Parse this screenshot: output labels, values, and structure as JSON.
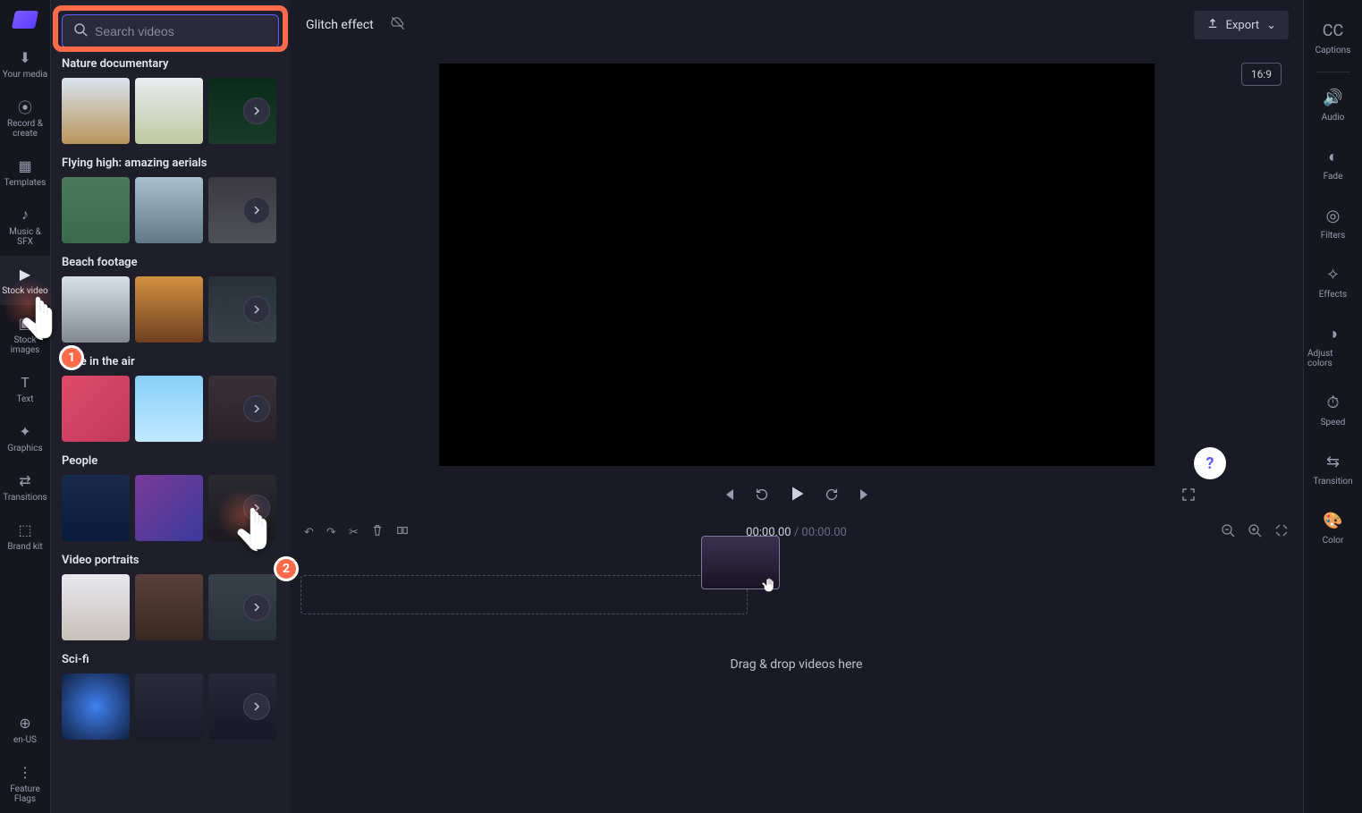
{
  "leftSidebar": [
    {
      "id": "your-media",
      "label": "Your media",
      "icon": "⬇"
    },
    {
      "id": "record",
      "label": "Record & create",
      "icon": "⦿"
    },
    {
      "id": "templates",
      "label": "Templates",
      "icon": "▦"
    },
    {
      "id": "music",
      "label": "Music & SFX",
      "icon": "♪"
    },
    {
      "id": "stock-video",
      "label": "Stock video",
      "icon": "▶",
      "active": true
    },
    {
      "id": "stock-images",
      "label": "Stock images",
      "icon": "▣"
    },
    {
      "id": "text",
      "label": "Text",
      "icon": "T"
    },
    {
      "id": "graphics",
      "label": "Graphics",
      "icon": "✦"
    },
    {
      "id": "transitions",
      "label": "Transitions",
      "icon": "⇄"
    },
    {
      "id": "brand-kit",
      "label": "Brand kit",
      "icon": "⬚"
    }
  ],
  "leftBottom": [
    {
      "id": "locale",
      "label": "en-US",
      "icon": "⊕"
    },
    {
      "id": "feature-flags",
      "label": "Feature Flags",
      "icon": "⋮"
    }
  ],
  "search": {
    "placeholder": "Search videos"
  },
  "categories": [
    {
      "title": "Nature documentary",
      "thumbs": [
        "t-wheat",
        "t-wheat2",
        "t-forest"
      ]
    },
    {
      "title": "Flying high: amazing aerials",
      "thumbs": [
        "t-aerial1",
        "t-aerial2",
        "t-aerial3"
      ]
    },
    {
      "title": "Beach footage",
      "thumbs": [
        "t-beach1",
        "t-beach2",
        "t-beach3"
      ]
    },
    {
      "title": "Love in the air",
      "thumbs": [
        "t-love1",
        "t-love2",
        "t-love3"
      ]
    },
    {
      "title": "People",
      "thumbs": [
        "t-people1",
        "t-people2",
        "t-people3"
      ]
    },
    {
      "title": "Video portraits",
      "thumbs": [
        "t-port1",
        "t-port2",
        "t-port3"
      ]
    },
    {
      "title": "Sci-fi",
      "thumbs": [
        "t-sci1",
        "t-sci2",
        "t-sci3"
      ]
    }
  ],
  "header": {
    "title": "Glitch effect",
    "export": "Export",
    "aspect": "16:9"
  },
  "playback": {
    "current": "00:00.00",
    "total": "00:00.00"
  },
  "timeline": {
    "hint": "Drag & drop videos here"
  },
  "rightSidebar": [
    {
      "id": "captions",
      "label": "Captions",
      "icon": "CC"
    },
    {
      "id": "audio",
      "label": "Audio",
      "icon": "🔊"
    },
    {
      "id": "fade",
      "label": "Fade",
      "icon": "◐"
    },
    {
      "id": "filters",
      "label": "Filters",
      "icon": "◎"
    },
    {
      "id": "effects",
      "label": "Effects",
      "icon": "✧"
    },
    {
      "id": "adjust",
      "label": "Adjust colors",
      "icon": "◑"
    },
    {
      "id": "speed",
      "label": "Speed",
      "icon": "⏱"
    },
    {
      "id": "transition",
      "label": "Transition",
      "icon": "⇆"
    },
    {
      "id": "color",
      "label": "Color",
      "icon": "🎨"
    }
  ],
  "annotations": {
    "pointer1": "1",
    "pointer2": "2"
  }
}
